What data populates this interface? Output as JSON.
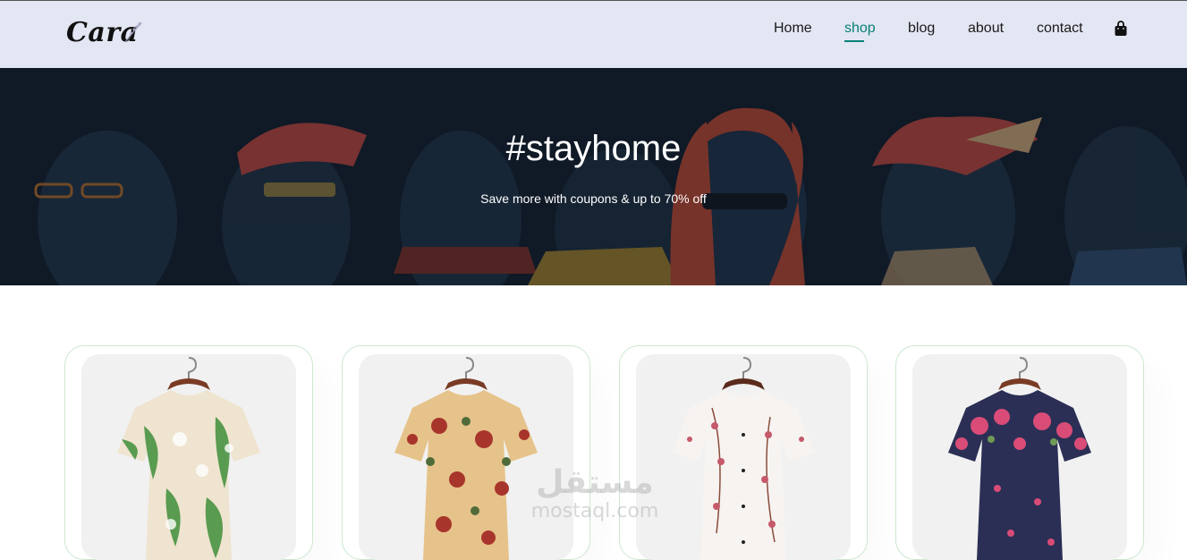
{
  "brand": {
    "logo_text": "Cara"
  },
  "nav": {
    "items": [
      {
        "label": "Home",
        "active": false
      },
      {
        "label": "shop",
        "active": true
      },
      {
        "label": "blog",
        "active": false
      },
      {
        "label": "about",
        "active": false
      },
      {
        "label": "contact",
        "active": false
      }
    ],
    "cart_icon": "shopping-bag-icon"
  },
  "hero": {
    "title": "#stayhome",
    "subtitle": "Save more with coupons & up to 70% off"
  },
  "products": [
    {
      "image": "green-floral-shirt",
      "accent": "#3f8f3a",
      "base": "#efe4cf"
    },
    {
      "image": "beige-red-floral-shirt",
      "accent": "#a8352c",
      "base": "#e6c38a"
    },
    {
      "image": "white-pink-blossom-shirt",
      "accent": "#c55a6a",
      "base": "#f6f3f1"
    },
    {
      "image": "navy-pink-rose-shirt",
      "accent": "#d94c78",
      "base": "#2b2f55"
    }
  ],
  "watermark": {
    "arabic": "مستقل",
    "latin": "mostaql.com"
  },
  "colors": {
    "accent": "#088178",
    "header_bg": "#e3e6f3",
    "hero_bg": "#15202e"
  }
}
